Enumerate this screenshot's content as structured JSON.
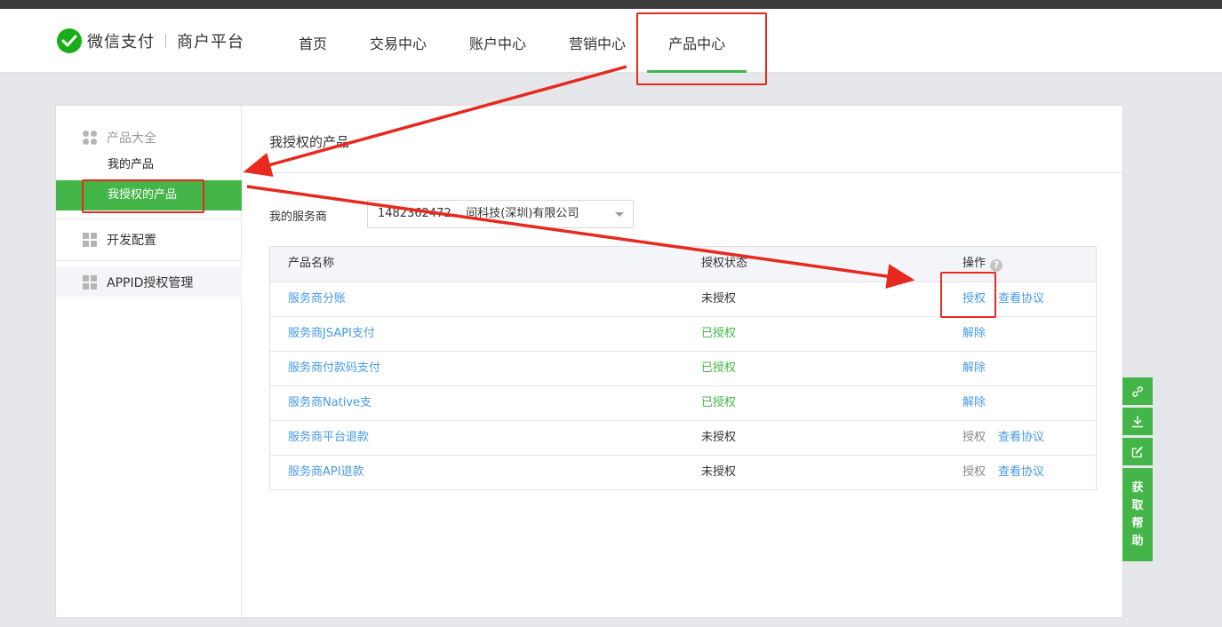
{
  "header": {
    "brand": "微信支付",
    "brand_sub": "商户平台",
    "nav": [
      {
        "label": "首页"
      },
      {
        "label": "交易中心"
      },
      {
        "label": "账户中心"
      },
      {
        "label": "营销中心"
      },
      {
        "label": "产品中心"
      }
    ],
    "active_nav": "产品中心"
  },
  "sidebar": {
    "group1_title": "产品大全",
    "group1_items": [
      {
        "label": "我的产品"
      },
      {
        "label": "我授权的产品"
      }
    ],
    "active_item": "我授权的产品",
    "group2_title": "开发配置",
    "group3_title": "APPID授权管理"
  },
  "main": {
    "title": "我授权的产品",
    "provider_label": "我的服务商",
    "provider_value": "1482362472    间科技(深圳)有限公司"
  },
  "table": {
    "headers": {
      "name": "产品名称",
      "status": "授权状态",
      "action": "操作"
    },
    "help_glyph": "?",
    "rows": [
      {
        "name": "服务商分账",
        "status": "未授权",
        "action1": "授权",
        "action2": "查看协议"
      },
      {
        "name": "服务商JSAPI支付",
        "status": "已授权",
        "action1": "解除",
        "action2": ""
      },
      {
        "name": "服务商付款码支付",
        "status": "已授权",
        "action1": "解除",
        "action2": ""
      },
      {
        "name": "服务商Native支",
        "status": "已授权",
        "action1": "解除",
        "action2": ""
      },
      {
        "name": "服务商平台退款",
        "status": "未授权",
        "action1": "授权",
        "action2": "查看协议"
      },
      {
        "name": "服务商API退款",
        "status": "未授权",
        "action1": "授权",
        "action2": "查看协议"
      }
    ]
  },
  "float_bar": {
    "help_label": "获取帮助",
    "help_chars": [
      "获",
      "取",
      "帮",
      "助"
    ]
  },
  "colors": {
    "accent": "#44b549",
    "link": "#459ae9",
    "annotation": "#e8291f"
  }
}
